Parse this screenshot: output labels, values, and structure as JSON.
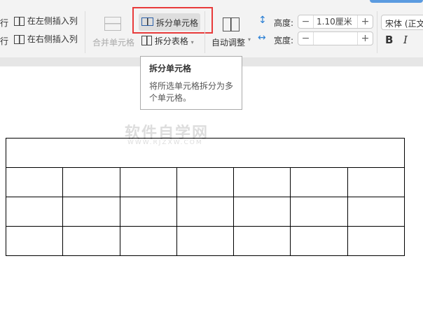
{
  "ribbon": {
    "row_insert_above_partial": "行",
    "row_insert_below_partial": "行",
    "insert_col_left": "在左侧插入列",
    "insert_col_right": "在右侧插入列",
    "merge_cells": "合并单元格",
    "split_cells": "拆分单元格",
    "split_table": "拆分表格",
    "auto_fit": "自动调整",
    "height_label": "高度:",
    "height_value": "1.10厘米",
    "width_label": "宽度:",
    "width_value": "",
    "font_name": "宋体 (正文",
    "bold": "B",
    "italic": "I",
    "minus": "−",
    "plus": "+"
  },
  "tooltip": {
    "title": "拆分单元格",
    "description": "将所选单元格拆分为多个单元格。"
  },
  "watermark": {
    "title": "软件自学网",
    "url": "WWW.RJZXW.COM"
  },
  "table": {
    "rows": 4,
    "cols": 7,
    "first_row_merged": true
  }
}
